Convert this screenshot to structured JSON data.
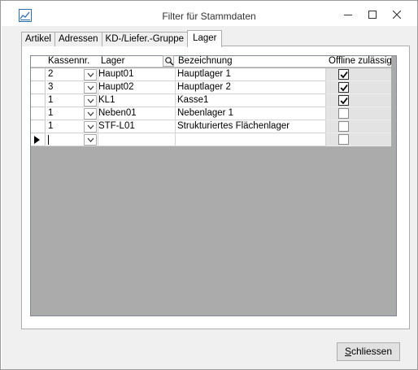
{
  "window": {
    "title": "Filter für Stammdaten",
    "app_icon": "chart-icon"
  },
  "tabs": [
    {
      "label": "Artikel",
      "active": false
    },
    {
      "label": "Adressen",
      "active": false
    },
    {
      "label": "KD-/Liefer.-Gruppe",
      "active": false
    },
    {
      "label": "Lager",
      "active": true
    }
  ],
  "grid": {
    "columns": {
      "kassennr": "Kassennr.",
      "lager": "Lager",
      "bezeichnung": "Bezeichnung",
      "offline": "Offline zulässig"
    },
    "rows": [
      {
        "kassennr": "2",
        "lager": "Haupt01",
        "bezeichnung": "Hauptlager 1",
        "offline": true
      },
      {
        "kassennr": "3",
        "lager": "Haupt02",
        "bezeichnung": "Hauptlager 2",
        "offline": true
      },
      {
        "kassennr": "1",
        "lager": "KL1",
        "bezeichnung": "Kasse1",
        "offline": true
      },
      {
        "kassennr": "1",
        "lager": "Neben01",
        "bezeichnung": "Nebenlager 1",
        "offline": false
      },
      {
        "kassennr": "1",
        "lager": "STF-L01",
        "bezeichnung": "Strukturiertes Flächenlager",
        "offline": false
      }
    ],
    "new_row": {
      "kassennr": "",
      "lager": "",
      "bezeichnung": "",
      "offline": false
    }
  },
  "buttons": {
    "close_mnemonic": "S",
    "close_rest": "chliessen"
  }
}
